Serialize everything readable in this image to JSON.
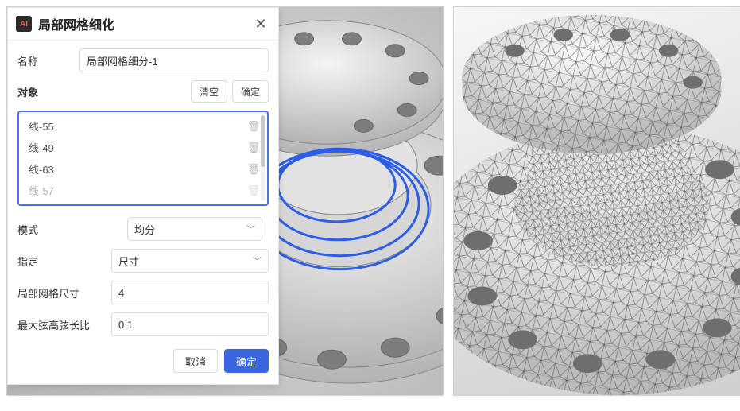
{
  "dialog": {
    "title": "局部网格细化",
    "name_label": "名称",
    "name_value": "局部网格细分-1",
    "objects_label": "对象",
    "clear_label": "清空",
    "confirm_small_label": "确定",
    "object_items": [
      "线-55",
      "线-49",
      "线-63",
      "线-57"
    ],
    "mode_label": "模式",
    "mode_value": "均分",
    "specify_label": "指定",
    "specify_value": "尺寸",
    "local_size_label": "局部网格尺寸",
    "local_size_value": "4",
    "chord_ratio_label": "最大弦高弦长比",
    "chord_ratio_value": "0.1",
    "cancel_label": "取消",
    "ok_label": "确定"
  },
  "icons": {
    "close": "✕",
    "chevron": "﹀",
    "trash": "🗑"
  }
}
